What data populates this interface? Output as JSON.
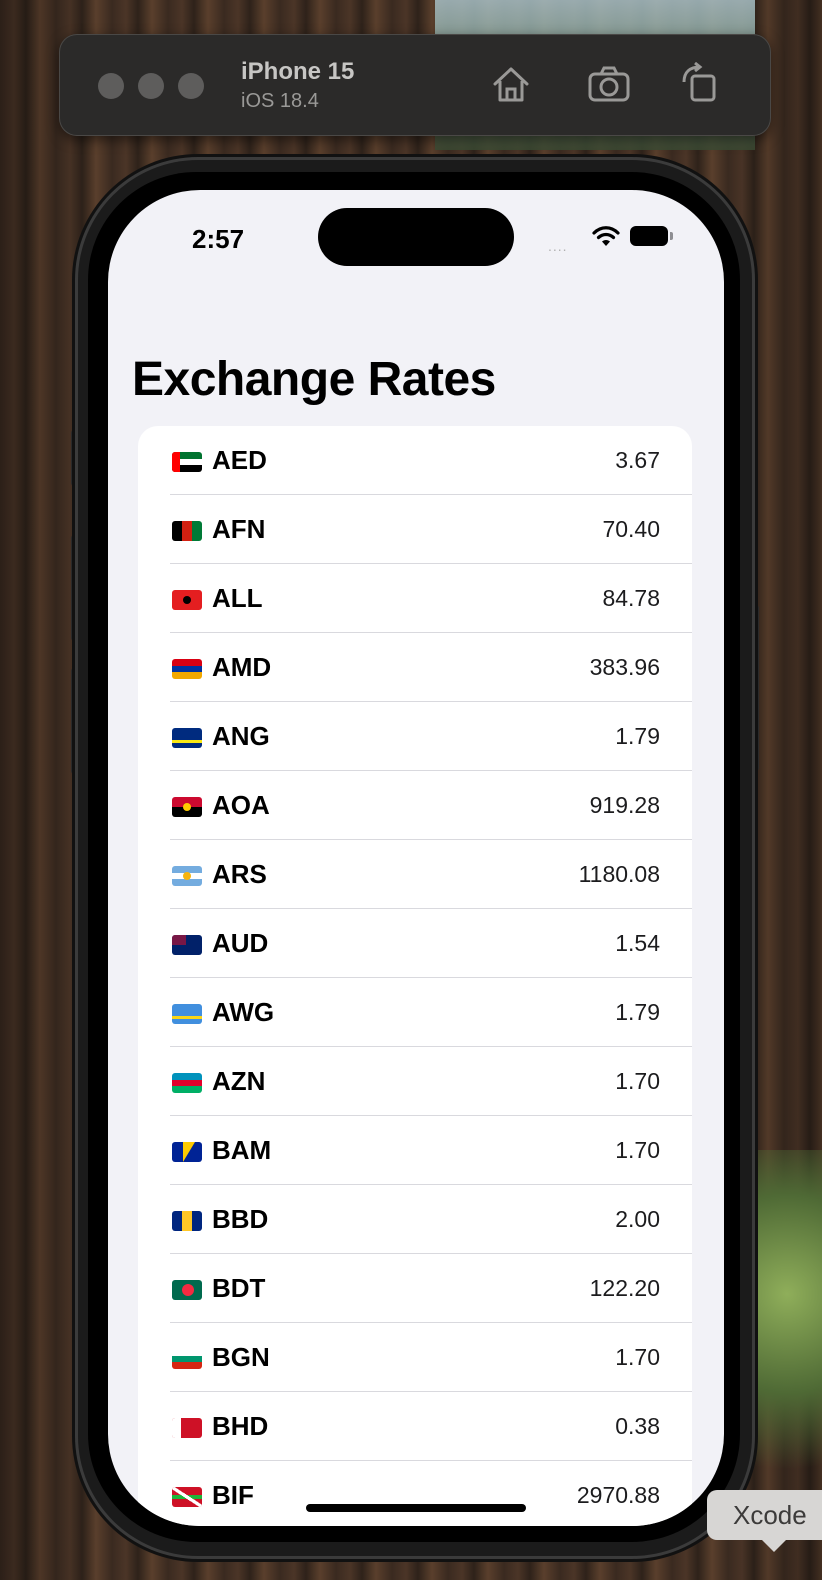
{
  "simulator": {
    "device_name": "iPhone 15",
    "os_version": "iOS 18.4",
    "buttons": [
      {
        "name": "home-icon"
      },
      {
        "name": "screenshot-icon"
      },
      {
        "name": "rotate-icon"
      }
    ]
  },
  "status_bar": {
    "time": "2:57",
    "signal": "....",
    "wifi_icon": "wifi-icon",
    "battery_icon": "battery-icon"
  },
  "page": {
    "title": "Exchange Rates"
  },
  "rates": [
    {
      "code": "AED",
      "rate": "3.67",
      "flag": "flag-ae"
    },
    {
      "code": "AFN",
      "rate": "70.40",
      "flag": "flag-af"
    },
    {
      "code": "ALL",
      "rate": "84.78",
      "flag": "flag-al"
    },
    {
      "code": "AMD",
      "rate": "383.96",
      "flag": "flag-am"
    },
    {
      "code": "ANG",
      "rate": "1.79",
      "flag": "flag-cw"
    },
    {
      "code": "AOA",
      "rate": "919.28",
      "flag": "flag-ao"
    },
    {
      "code": "ARS",
      "rate": "1180.08",
      "flag": "flag-ar"
    },
    {
      "code": "AUD",
      "rate": "1.54",
      "flag": "flag-au"
    },
    {
      "code": "AWG",
      "rate": "1.79",
      "flag": "flag-aw"
    },
    {
      "code": "AZN",
      "rate": "1.70",
      "flag": "flag-az"
    },
    {
      "code": "BAM",
      "rate": "1.70",
      "flag": "flag-ba"
    },
    {
      "code": "BBD",
      "rate": "2.00",
      "flag": "flag-bb"
    },
    {
      "code": "BDT",
      "rate": "122.20",
      "flag": "flag-bd"
    },
    {
      "code": "BGN",
      "rate": "1.70",
      "flag": "flag-bg"
    },
    {
      "code": "BHD",
      "rate": "0.38",
      "flag": "flag-bh"
    },
    {
      "code": "BIF",
      "rate": "2970.88",
      "flag": "flag-bi"
    }
  ],
  "tooltip": {
    "label": "Xcode"
  }
}
